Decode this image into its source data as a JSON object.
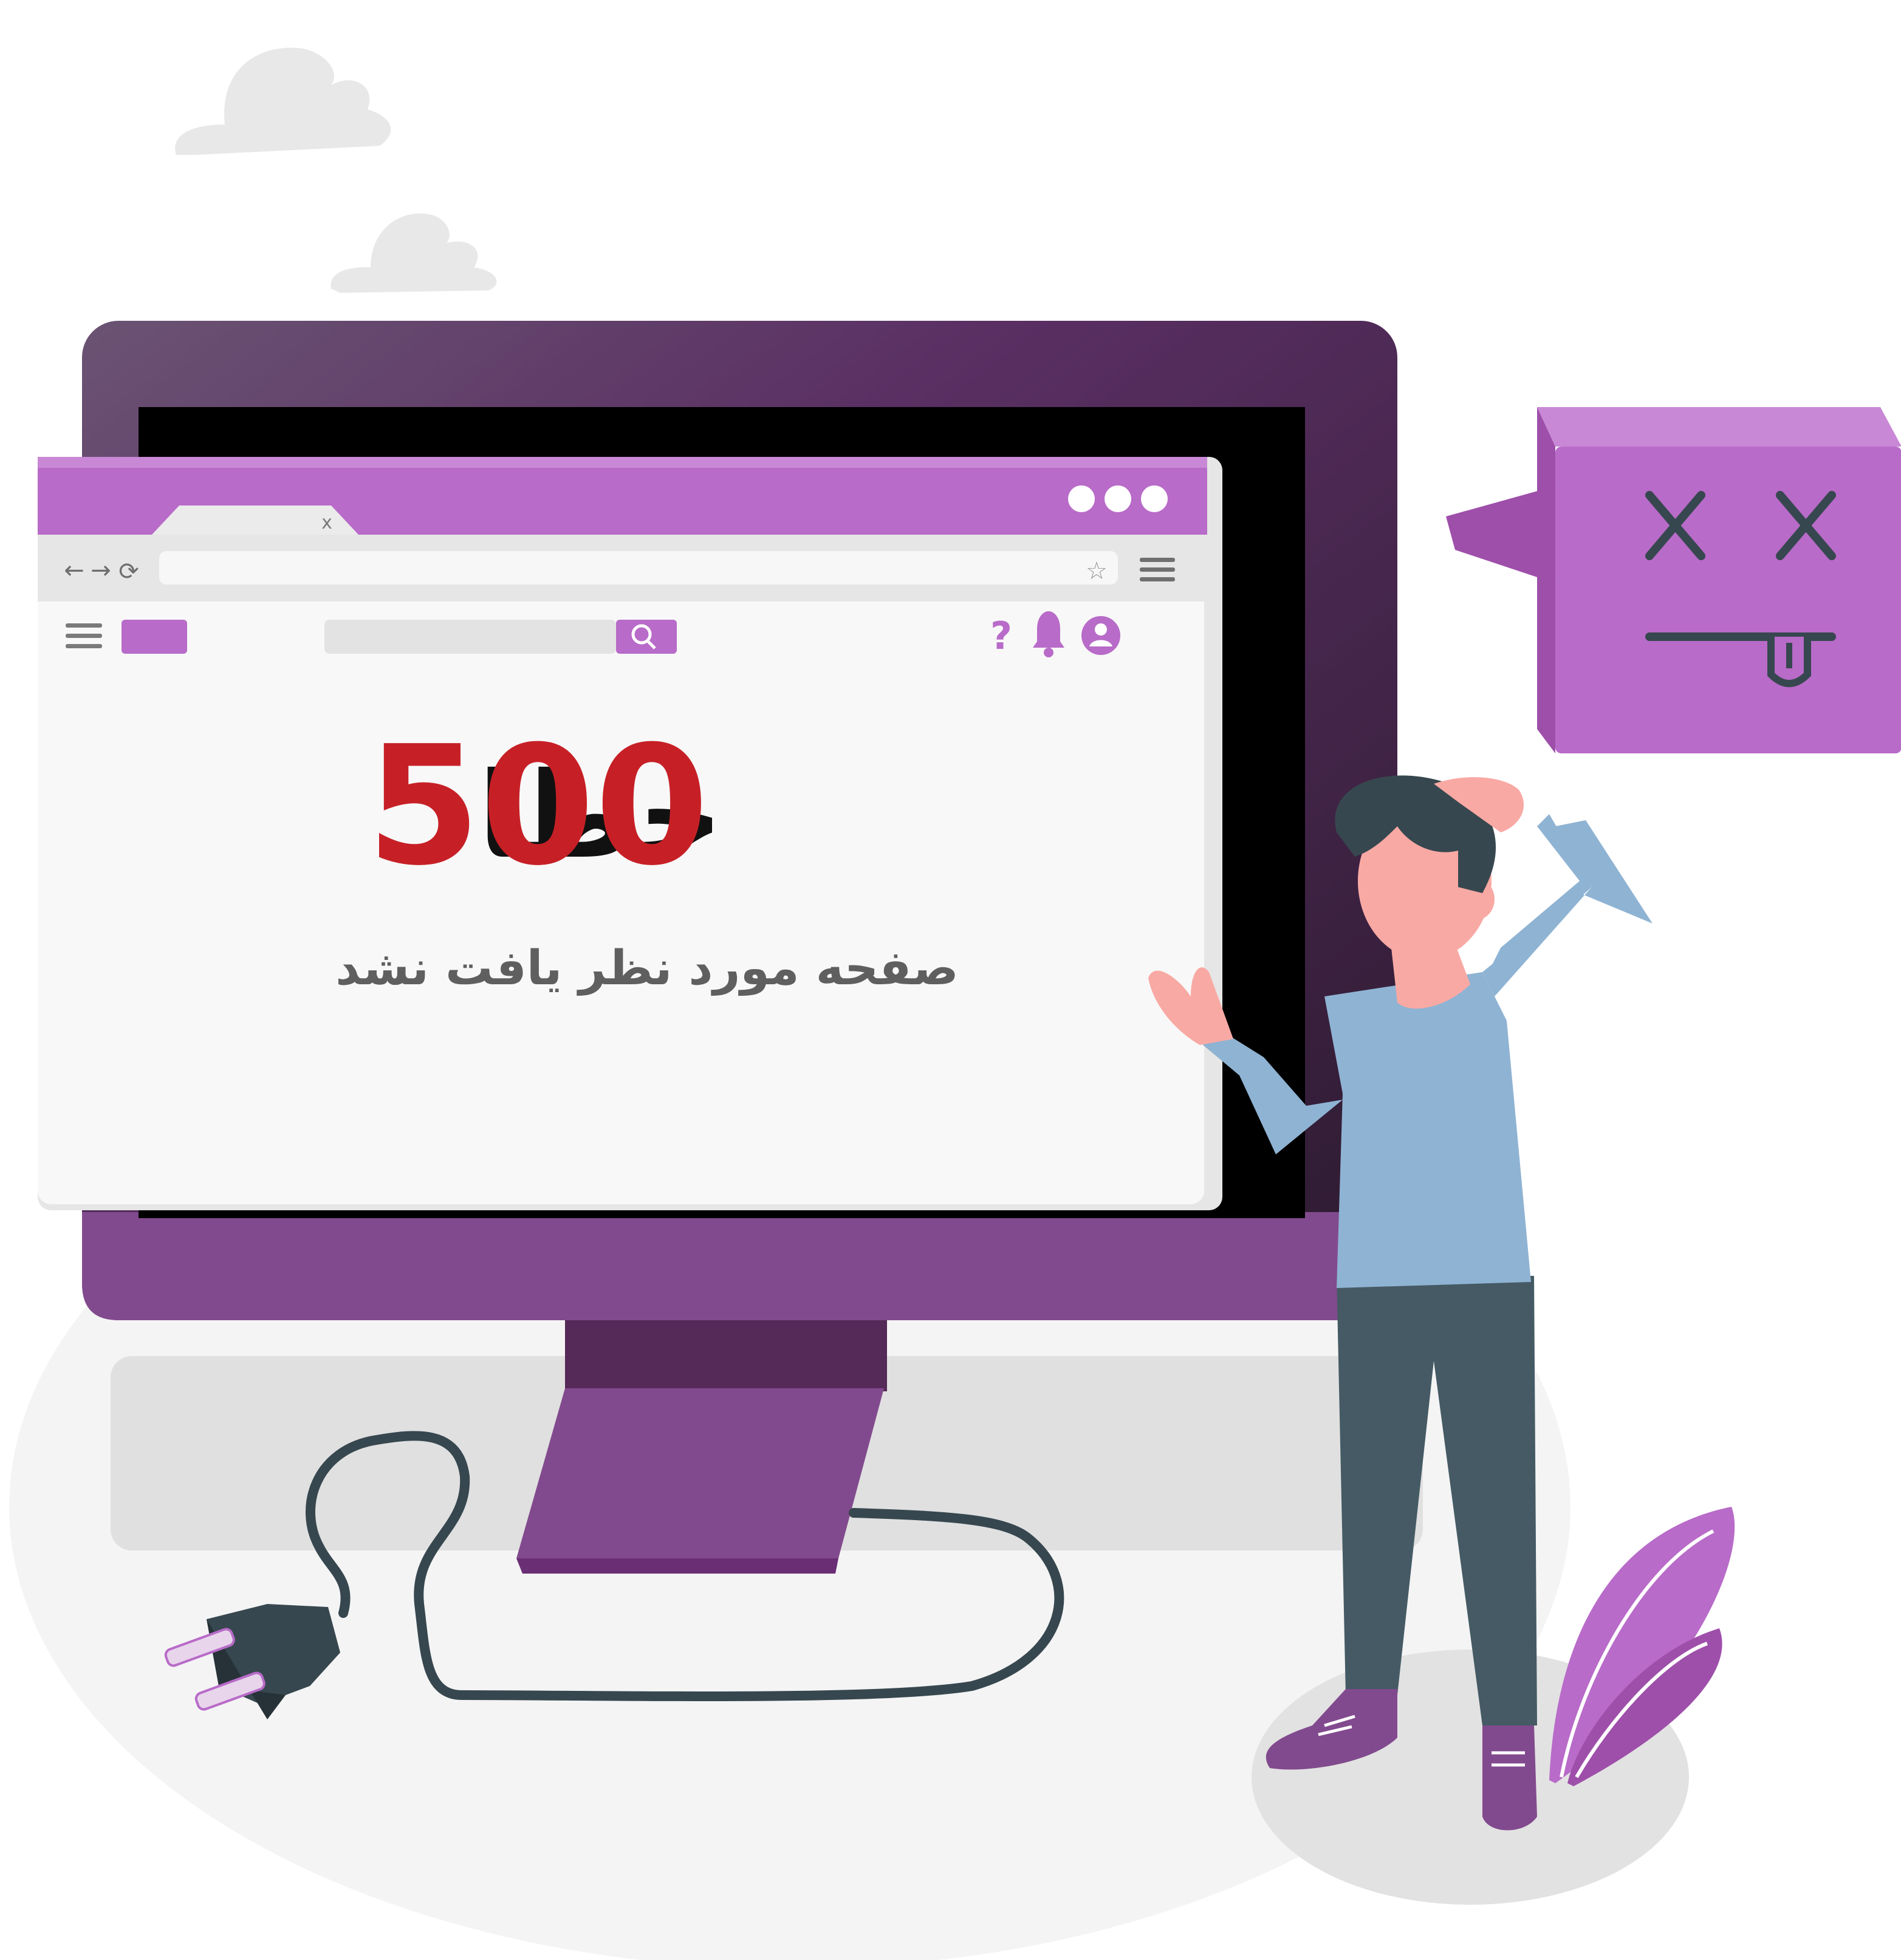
{
  "browser": {
    "tab_close_glyph": "x",
    "nav_back_glyph": "←",
    "nav_forward_glyph": "→",
    "nav_reload_glyph": "⟳",
    "bookmark_glyph": "☆",
    "help_glyph": "?"
  },
  "error": {
    "title_word": "خطا",
    "code": "500",
    "message": "صفحه مورد نظر یافت نشد"
  },
  "colors": {
    "purple_primary": "#B86BC8",
    "purple_dark": "#3E1A43",
    "purple_monitor": "#824A8E",
    "error_red": "#C62026",
    "text_gray": "#5F5F5F"
  }
}
